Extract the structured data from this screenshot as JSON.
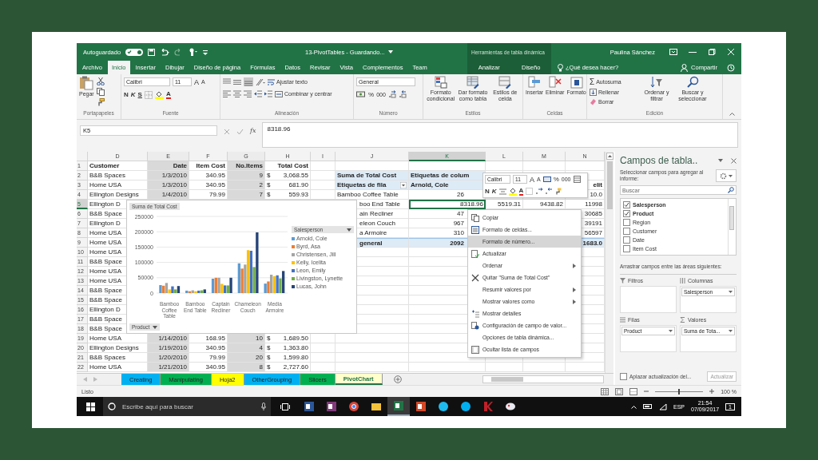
{
  "window": {
    "autosave_label": "Autoguardado",
    "autosave_on": true,
    "title": "13-PivotTables - Guardando...",
    "context_group": "Herramientas de tabla dinámica",
    "user": "Paulina Sánchez"
  },
  "menu_tabs": [
    {
      "label": "Archivo",
      "kind": "normal",
      "selected": false
    },
    {
      "label": "Inicio",
      "kind": "normal",
      "selected": true
    },
    {
      "label": "Insertar",
      "kind": "normal",
      "selected": false
    },
    {
      "label": "Dibujar",
      "kind": "normal",
      "selected": false
    },
    {
      "label": "Diseño de página",
      "kind": "normal",
      "selected": false
    },
    {
      "label": "Fórmulas",
      "kind": "normal",
      "selected": false
    },
    {
      "label": "Datos",
      "kind": "normal",
      "selected": false
    },
    {
      "label": "Revisar",
      "kind": "normal",
      "selected": false
    },
    {
      "label": "Vista",
      "kind": "normal",
      "selected": false
    },
    {
      "label": "Complementos",
      "kind": "normal",
      "selected": false
    },
    {
      "label": "Team",
      "kind": "normal",
      "selected": false
    },
    {
      "label": "Analizar",
      "kind": "context",
      "selected": false
    },
    {
      "label": "Diseño",
      "kind": "context",
      "selected": false
    }
  ],
  "tell_me": "¿Qué desea hacer?",
  "share": "Compartir",
  "ribbon": {
    "clipboard": {
      "label": "Portapapeles",
      "paste": "Pegar"
    },
    "font": {
      "label": "Fuente",
      "family": "Calibri",
      "size": "11",
      "grow": "A",
      "shrink": "A",
      "bold": "N",
      "italic": "K",
      "underline": "S",
      "font_color_letter": "A"
    },
    "alignment": {
      "label": "Alineación",
      "wrap": "Ajustar texto",
      "merge": "Combinar y centrar"
    },
    "number": {
      "label": "Número",
      "format": "General",
      "percent": "%",
      "thousands": "000"
    },
    "styles": {
      "label": "Estilos",
      "buttons": [
        "Formato condicional",
        "Dar formato como tabla",
        "Estilos de celda"
      ]
    },
    "cells": {
      "label": "Celdas",
      "buttons": [
        "Insertar",
        "Eliminar",
        "Formato"
      ]
    },
    "editing": {
      "label": "Edición",
      "sum_symbol": "Σ",
      "autosum": "Autosuma",
      "fill": "Rellenar",
      "clear": "Borrar",
      "sort": "Ordenar y filtrar",
      "find": "Buscar y seleccionar"
    }
  },
  "formula_bar": {
    "name_box": "K5",
    "fx": "fx",
    "value": "8318.96"
  },
  "sheet": {
    "columns": [
      {
        "letter": "D",
        "shaded": false
      },
      {
        "letter": "E",
        "shaded": true
      },
      {
        "letter": "F",
        "shaded": false
      },
      {
        "letter": "G",
        "shaded": true
      },
      {
        "letter": "H",
        "shaded": false
      },
      {
        "letter": "I",
        "shaded": false
      },
      {
        "letter": "J",
        "shaded": false
      },
      {
        "letter": "K",
        "shaded": false
      },
      {
        "letter": "L",
        "shaded": false
      },
      {
        "letter": "M",
        "shaded": false
      },
      {
        "letter": "N",
        "shaded": false
      }
    ],
    "rows": [
      {
        "number": "1",
        "cells": {
          "D": {
            "text": "Customer",
            "kind": "heading"
          },
          "E": {
            "text": "Date",
            "kind": "heading-num"
          },
          "F": {
            "text": "Item Cost",
            "kind": "heading-num"
          },
          "G": {
            "text": "No.Items",
            "kind": "heading-num"
          },
          "H": {
            "text": "Total Cost",
            "kind": "heading-num"
          }
        }
      },
      {
        "number": "2",
        "cells": {
          "D": {
            "text": "B&B Spaces",
            "kind": "text"
          },
          "E": {
            "text": "1/3/2010",
            "kind": "number"
          },
          "F": {
            "text": "340.95",
            "kind": "number"
          },
          "G": {
            "text": "9",
            "kind": "number"
          },
          "H": {
            "symbol": "$",
            "text": "3,068.55",
            "kind": "money"
          },
          "J": {
            "text": "Suma de Total Cost",
            "kind": "pivot-heading"
          },
          "K": {
            "text": "Etiquetas de colum",
            "kind": "pivot-heading"
          }
        }
      },
      {
        "number": "3",
        "cells": {
          "D": {
            "text": "Home USA",
            "kind": "text"
          },
          "E": {
            "text": "1/3/2010",
            "kind": "number"
          },
          "F": {
            "text": "340.95",
            "kind": "number"
          },
          "G": {
            "text": "2",
            "kind": "number"
          },
          "H": {
            "symbol": "$",
            "text": "681.90",
            "kind": "money"
          },
          "J": {
            "text": "Etiquetas de fila",
            "kind": "pivot-filter"
          },
          "K": {
            "text": "Arnold, Cole",
            "kind": "pivot-heading"
          },
          "N": {
            "text": "elit",
            "kind": "heading-num"
          }
        }
      },
      {
        "number": "4",
        "cells": {
          "D": {
            "text": "Ellington Designs",
            "kind": "text"
          },
          "E": {
            "text": "1/4/2010",
            "kind": "number"
          },
          "F": {
            "text": "79.99",
            "kind": "number"
          },
          "G": {
            "text": "7",
            "kind": "number"
          },
          "H": {
            "symbol": "$",
            "text": "559.93",
            "kind": "money"
          },
          "J": {
            "text": "Bamboo Coffee Table",
            "kind": "text"
          },
          "K": {
            "text": "26",
            "kind": "number"
          },
          "N": {
            "text": "10.0",
            "kind": "number"
          }
        }
      },
      {
        "number": "5",
        "cells": {
          "D": {
            "text": "Ellington D",
            "kind": "text"
          },
          "J": {
            "text": "boo End Table",
            "kind": "text"
          },
          "K": {
            "text": "8318.96",
            "kind": "active-number"
          },
          "L": {
            "text": "5519.31",
            "kind": "number"
          },
          "M": {
            "text": "9438.82",
            "kind": "number"
          },
          "N": {
            "text": "11998",
            "kind": "number"
          }
        }
      },
      {
        "number": "6",
        "cells": {
          "D": {
            "text": "B&B Space",
            "kind": "text"
          },
          "J": {
            "text": "ain Recliner",
            "kind": "text"
          },
          "K": {
            "text": "47",
            "kind": "number"
          },
          "N": {
            "text": "30685",
            "kind": "number"
          }
        }
      },
      {
        "number": "7",
        "cells": {
          "D": {
            "text": "Ellington D",
            "kind": "text"
          },
          "J": {
            "text": "eleon Couch",
            "kind": "text"
          },
          "K": {
            "text": "967",
            "kind": "number"
          },
          "N": {
            "text": "39191",
            "kind": "number"
          }
        }
      },
      {
        "number": "8",
        "cells": {
          "D": {
            "text": "Home USA",
            "kind": "text"
          },
          "J": {
            "text": "a Armoire",
            "kind": "text"
          },
          "K": {
            "text": "310",
            "kind": "number"
          },
          "N": {
            "text": "56597",
            "kind": "number"
          }
        }
      },
      {
        "number": "9",
        "cells": {
          "D": {
            "text": "Home USA",
            "kind": "text"
          },
          "J": {
            "text": "general",
            "kind": "pivot-total"
          },
          "K": {
            "text": "2092",
            "kind": "pivot-total-num"
          },
          "N": {
            "text": "1683.0",
            "kind": "pivot-total-num"
          }
        }
      },
      {
        "number": "10",
        "cells": {
          "D": {
            "text": "Home USA",
            "kind": "text"
          }
        }
      },
      {
        "number": "11",
        "cells": {
          "D": {
            "text": "B&B Space",
            "kind": "text"
          }
        }
      },
      {
        "number": "12",
        "cells": {
          "D": {
            "text": "Home USA",
            "kind": "text"
          }
        }
      },
      {
        "number": "13",
        "cells": {
          "D": {
            "text": "Home USA",
            "kind": "text"
          }
        }
      },
      {
        "number": "14",
        "cells": {
          "D": {
            "text": "B&B Space",
            "kind": "text"
          }
        }
      },
      {
        "number": "15",
        "cells": {
          "D": {
            "text": "B&B Space",
            "kind": "text"
          }
        }
      },
      {
        "number": "16",
        "cells": {
          "D": {
            "text": "Ellington D",
            "kind": "text"
          }
        }
      },
      {
        "number": "17",
        "cells": {
          "D": {
            "text": "B&B Space",
            "kind": "text"
          }
        }
      },
      {
        "number": "18",
        "cells": {
          "D": {
            "text": "B&B Space",
            "kind": "text"
          }
        }
      },
      {
        "number": "19",
        "cells": {
          "D": {
            "text": "Home USA",
            "kind": "text"
          },
          "E": {
            "text": "1/14/2010",
            "kind": "number"
          },
          "F": {
            "text": "168.95",
            "kind": "number"
          },
          "G": {
            "text": "10",
            "kind": "number"
          },
          "H": {
            "symbol": "$",
            "text": "1,689.50",
            "kind": "money"
          }
        }
      },
      {
        "number": "20",
        "cells": {
          "D": {
            "text": "Ellington Designs",
            "kind": "text"
          },
          "E": {
            "text": "1/19/2010",
            "kind": "number"
          },
          "F": {
            "text": "340.95",
            "kind": "number"
          },
          "G": {
            "text": "4",
            "kind": "number"
          },
          "H": {
            "symbol": "$",
            "text": "1,363.80",
            "kind": "money"
          }
        }
      },
      {
        "number": "21",
        "cells": {
          "D": {
            "text": "B&B Spaces",
            "kind": "text"
          },
          "E": {
            "text": "1/20/2010",
            "kind": "number"
          },
          "F": {
            "text": "79.99",
            "kind": "number"
          },
          "G": {
            "text": "20",
            "kind": "number"
          },
          "H": {
            "symbol": "$",
            "text": "1,599.80",
            "kind": "money"
          }
        }
      },
      {
        "number": "22",
        "cells": {
          "D": {
            "text": "Home USA",
            "kind": "text"
          },
          "E": {
            "text": "1/21/2010",
            "kind": "number"
          },
          "F": {
            "text": "340.95",
            "kind": "number"
          },
          "G": {
            "text": "8",
            "kind": "number"
          },
          "H": {
            "symbol": "$",
            "text": "2,727.60",
            "kind": "money"
          }
        }
      }
    ]
  },
  "pivot_chart": {
    "value_button": "Suma de Total Cost",
    "legend_button": "Salesperson",
    "axis_button": "Product",
    "chart_data": {
      "type": "bar",
      "categories": [
        "Bamboo Coffee Table",
        "Bamboo End Table",
        "Captain Recliner",
        "Chameleon Couch",
        "Media Armoire"
      ],
      "ylim": [
        0,
        250000
      ],
      "yticks": [
        0,
        50000,
        100000,
        150000,
        200000,
        250000
      ],
      "grid": true,
      "legend": true,
      "series": [
        {
          "name": "Arnold, Cole",
          "color": "#5b9bd5",
          "values": [
            26000,
            8000,
            47000,
            97000,
            31000
          ]
        },
        {
          "name": "Byrd, Asa",
          "color": "#ed7d31",
          "values": [
            24000,
            6000,
            50000,
            80000,
            38000
          ]
        },
        {
          "name": "Christensen, Jill",
          "color": "#a5a5a5",
          "values": [
            33000,
            9000,
            50000,
            93000,
            60000
          ]
        },
        {
          "name": "Kelly, Icelita",
          "color": "#ffc000",
          "values": [
            12000,
            6000,
            30000,
            140000,
            55000
          ]
        },
        {
          "name": "Leon, Emily",
          "color": "#4472c4",
          "values": [
            22000,
            8000,
            25000,
            138000,
            58000
          ]
        },
        {
          "name": "Livingston, Lynette",
          "color": "#70ad47",
          "values": [
            12000,
            9000,
            25000,
            85000,
            48000
          ]
        },
        {
          "name": "Lucas, John",
          "color": "#264478",
          "values": [
            23000,
            12000,
            50000,
            198000,
            72000
          ]
        }
      ]
    }
  },
  "mini_toolbar": {
    "font": "Calibri",
    "size": "11",
    "grow": "A",
    "shrink": "A",
    "percent": "%",
    "thousands": "000",
    "bold": "N",
    "italic": "K",
    "font_color_letter": "A"
  },
  "context_menu": [
    {
      "label": "Copiar",
      "kind": "copy",
      "submenu": false,
      "selected": false
    },
    {
      "label": "Formato de celdas...",
      "kind": "format-cells",
      "submenu": false,
      "selected": false
    },
    {
      "label": "Formato de número...",
      "kind": "plain",
      "submenu": false,
      "selected": true
    },
    {
      "label": "Actualizar",
      "kind": "refresh",
      "submenu": false,
      "selected": false
    },
    {
      "label": "Ordenar",
      "kind": "plain",
      "submenu": true,
      "selected": false
    },
    {
      "label": "Quitar \"Suma de Total Cost\"",
      "kind": "remove",
      "submenu": false,
      "selected": false
    },
    {
      "label": "Resumir valores por",
      "kind": "plain",
      "submenu": true,
      "selected": false
    },
    {
      "label": "Mostrar valores como",
      "kind": "plain",
      "submenu": true,
      "selected": false
    },
    {
      "label": "Mostrar detalles",
      "kind": "details",
      "submenu": false,
      "selected": false
    },
    {
      "label": "Configuración de campo de valor...",
      "kind": "settings",
      "submenu": false,
      "selected": false
    },
    {
      "label": "Opciones de tabla dinámica...",
      "kind": "plain",
      "submenu": false,
      "selected": false
    },
    {
      "label": "Ocultar lista de campos",
      "kind": "hide-list",
      "submenu": false,
      "selected": false
    }
  ],
  "sheet_tabs": [
    {
      "label": "Creating",
      "color": "#00b0f0",
      "selected": false
    },
    {
      "label": "Manipulating",
      "color": "#00b050",
      "selected": false
    },
    {
      "label": "Hoja2",
      "color": "#ffff00",
      "selected": false
    },
    {
      "label": "OtherGrouping",
      "color": "#00b0f0",
      "selected": false
    },
    {
      "label": "Slicers",
      "color": "#00b050",
      "selected": false
    },
    {
      "label": "PivotChart",
      "color": "#ffffcc",
      "selected": true
    }
  ],
  "field_pane": {
    "title": "Campos de tabla..",
    "instruction": "Seleccionar campos para agregar al informe:",
    "search_placeholder": "Buscar",
    "fields": [
      {
        "label": "Salesperson",
        "checked": true
      },
      {
        "label": "Product",
        "checked": true
      },
      {
        "label": "Region",
        "checked": false
      },
      {
        "label": "Customer",
        "checked": false
      },
      {
        "label": "Date",
        "checked": false
      },
      {
        "label": "Item Cost",
        "checked": false
      }
    ],
    "areas_hint": "Arrastrar campos entre las áreas siguientes:",
    "areas": [
      {
        "label": "Filtros",
        "kind": "filters"
      },
      {
        "label": "Columnas",
        "kind": "columns",
        "field": "Salesperson"
      },
      {
        "label": "Filas",
        "kind": "rows",
        "field": "Product"
      },
      {
        "label": "Valores",
        "kind": "values",
        "field": "Suma de Tota..."
      }
    ],
    "defer": {
      "label": "Aplazar actualización del...",
      "checked": false
    },
    "update_button": {
      "label": "Actualizar",
      "disabled": true
    }
  },
  "status_bar": {
    "text": "Listo",
    "zoom": "100 %",
    "zoom_slider": {
      "level": 0.5
    }
  },
  "taskbar": {
    "search_placeholder": "Escribe aquí para buscar",
    "apps": [
      {
        "kind": "word",
        "active": false
      },
      {
        "kind": "onenote",
        "active": false
      },
      {
        "kind": "chrome",
        "active": false
      },
      {
        "kind": "explorer",
        "active": false
      },
      {
        "kind": "excel",
        "active": true
      },
      {
        "kind": "powerpoint",
        "active": false
      },
      {
        "kind": "ie",
        "active": false
      },
      {
        "kind": "skype",
        "active": false
      },
      {
        "kind": "antivirus",
        "active": false
      },
      {
        "kind": "paint",
        "active": false
      }
    ],
    "language": "ESP",
    "time": "21:54",
    "date": "07/09/2017",
    "notifications": "1"
  }
}
